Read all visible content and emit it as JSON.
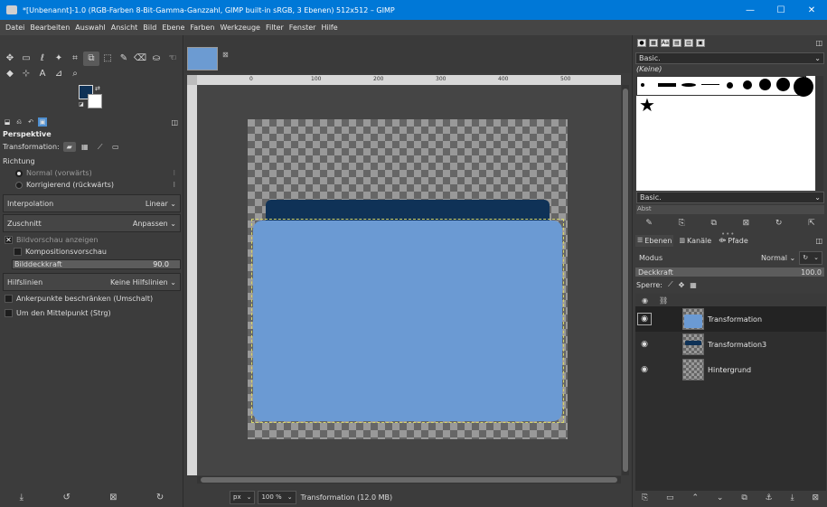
{
  "window": {
    "title": "*[Unbenannt]-1.0 (RGB-Farben 8-Bit-Gamma-Ganzzahl, GIMP built-in sRGB, 3 Ebenen) 512x512 – GIMP",
    "minimize": "—",
    "maximize": "☐",
    "close": "✕"
  },
  "menu": [
    "Datei",
    "Bearbeiten",
    "Auswahl",
    "Ansicht",
    "Bild",
    "Ebene",
    "Farben",
    "Werkzeuge",
    "Filter",
    "Fenster",
    "Hilfe"
  ],
  "colors": {
    "foreground": "#0f3257",
    "background": "#ffffff",
    "shape_blue": "#6b9ad3",
    "accent": "#0078d7"
  },
  "tool_options": {
    "title": "Perspektive",
    "transformation_label": "Transformation:",
    "direction_label": "Richtung",
    "direction_normal": "Normal (vorwärts)",
    "direction_corrective": "Korrigierend (rückwärts)",
    "interpolation_label": "Interpolation",
    "interpolation_value": "Linear",
    "clipping_label": "Zuschnitt",
    "clipping_value": "Anpassen",
    "preview_label": "Bildvorschau anzeigen",
    "composite_label": "Kompositionsvorschau",
    "opacity_label": "Bilddeckkraft",
    "opacity_value": "90.0",
    "guides_label": "Hilfslinien",
    "guides_value": "Keine Hilfslinien",
    "constrain_label": "Ankerpunkte beschränken (Umschalt)",
    "center_label": "Um den Mittelpunkt (Strg)"
  },
  "status": {
    "unit": "px",
    "zoom": "100 %",
    "text": "Transformation (12.0 MB)"
  },
  "brushes": {
    "preset": "Basic.",
    "selected": "(Keine)",
    "footer_preset": "Basic.",
    "spacing_label": "Abst"
  },
  "layers_panel": {
    "tab_layers": "Ebenen",
    "tab_channels": "Kanäle",
    "tab_paths": "Pfade",
    "mode_label": "Modus",
    "mode_value": "Normal",
    "opacity_label": "Deckkraft",
    "opacity_value": "100.0",
    "lock_label": "Sperre:",
    "layers": [
      {
        "name": "Transformation"
      },
      {
        "name": "Transformation3"
      },
      {
        "name": "Hintergrund"
      }
    ]
  },
  "ruler_labels": [
    "0",
    "100",
    "200",
    "300",
    "400",
    "500"
  ]
}
